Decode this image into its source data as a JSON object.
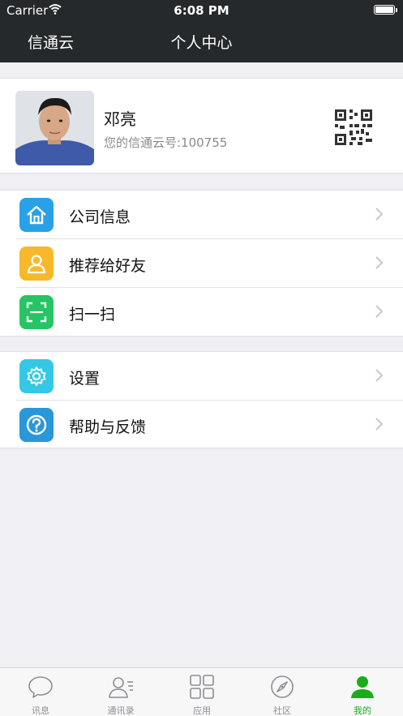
{
  "status_bar": {
    "carrier": "Carrier",
    "time": "6:08 PM"
  },
  "nav": {
    "app_name": "信通云",
    "title": "个人中心"
  },
  "profile": {
    "name": "邓亮",
    "account": "您的信通云号:100755"
  },
  "menu_group_1": [
    {
      "label": "公司信息",
      "icon": "house-icon",
      "color": "#29a1e8"
    },
    {
      "label": "推荐给好友",
      "icon": "person-icon",
      "color": "#f6b92b"
    },
    {
      "label": "扫一扫",
      "icon": "scan-icon",
      "color": "#26c465"
    }
  ],
  "menu_group_2": [
    {
      "label": "设置",
      "icon": "gear-icon",
      "color": "#34c8e6"
    },
    {
      "label": "帮助与反馈",
      "icon": "help-icon",
      "color": "#2a97d8"
    }
  ],
  "tabs": [
    {
      "label": "讯息",
      "icon": "chat-bubble-icon",
      "active": false
    },
    {
      "label": "通讯录",
      "icon": "contacts-icon",
      "active": false
    },
    {
      "label": "应用",
      "icon": "grid-icon",
      "active": false
    },
    {
      "label": "社区",
      "icon": "compass-icon",
      "active": false
    },
    {
      "label": "我的",
      "icon": "user-icon",
      "active": true
    }
  ],
  "colors": {
    "nav_bg": "#25292b",
    "accent_green": "#1aad19",
    "page_bg": "#efeff4"
  }
}
